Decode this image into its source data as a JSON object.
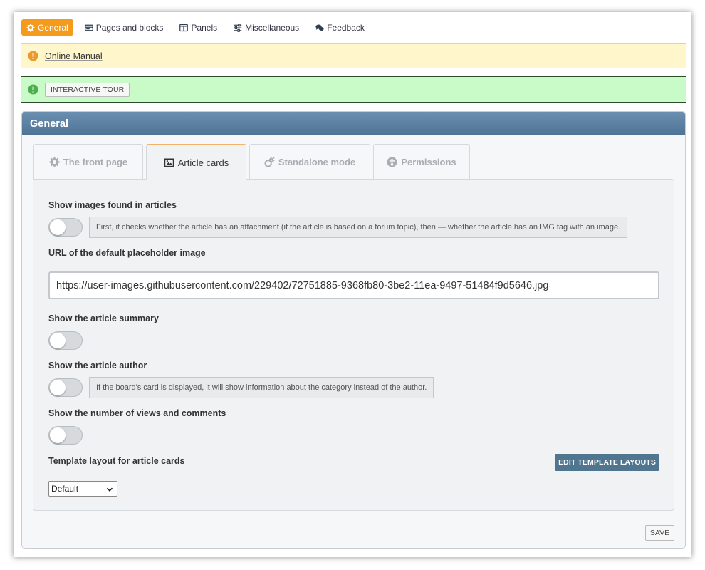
{
  "topnav": {
    "items": [
      {
        "label": "General",
        "icon": "gear-icon",
        "active": true
      },
      {
        "label": "Pages and blocks",
        "icon": "card-icon"
      },
      {
        "label": "Panels",
        "icon": "columns-icon"
      },
      {
        "label": "Miscellaneous",
        "icon": "sliders-icon"
      },
      {
        "label": "Feedback",
        "icon": "comments-icon"
      }
    ]
  },
  "notices": {
    "manual_link": "Online Manual",
    "tour_button": "INTERACTIVE TOUR"
  },
  "panel": {
    "title": "General",
    "tabs": [
      {
        "label": "The front page",
        "icon": "gear-icon"
      },
      {
        "label": "Article cards",
        "icon": "image-icon",
        "active": true
      },
      {
        "label": "Standalone mode",
        "icon": "meteor-icon"
      },
      {
        "label": "Permissions",
        "icon": "accessibility-icon"
      }
    ]
  },
  "settings": {
    "show_images": {
      "label": "Show images found in articles",
      "enabled": false,
      "hint": "First, it checks whether the article has an attachment (if the article is based on a forum topic), then — whether the article has an IMG tag with an image."
    },
    "placeholder_url": {
      "label": "URL of the default placeholder image",
      "value": "https://user-images.githubusercontent.com/229402/72751885-9368fb80-3be2-11ea-9497-51484f9d5646.jpg"
    },
    "show_summary": {
      "label": "Show the article summary",
      "enabled": false
    },
    "show_author": {
      "label": "Show the article author",
      "enabled": false,
      "hint": "If the board's card is displayed, it will show information about the category instead of the author."
    },
    "show_views": {
      "label": "Show the number of views and comments",
      "enabled": false
    },
    "template_layout": {
      "label": "Template layout for article cards",
      "selected": "Default",
      "edit_button": "EDIT TEMPLATE LAYOUTS"
    }
  },
  "save_button": "SAVE",
  "colors": {
    "accent_orange": "#f49a1c",
    "panel_header": "#5a7f9f",
    "notice_yellow": "#fff6cc",
    "notice_green": "#c9fbc9",
    "button_blue": "#50758f"
  }
}
